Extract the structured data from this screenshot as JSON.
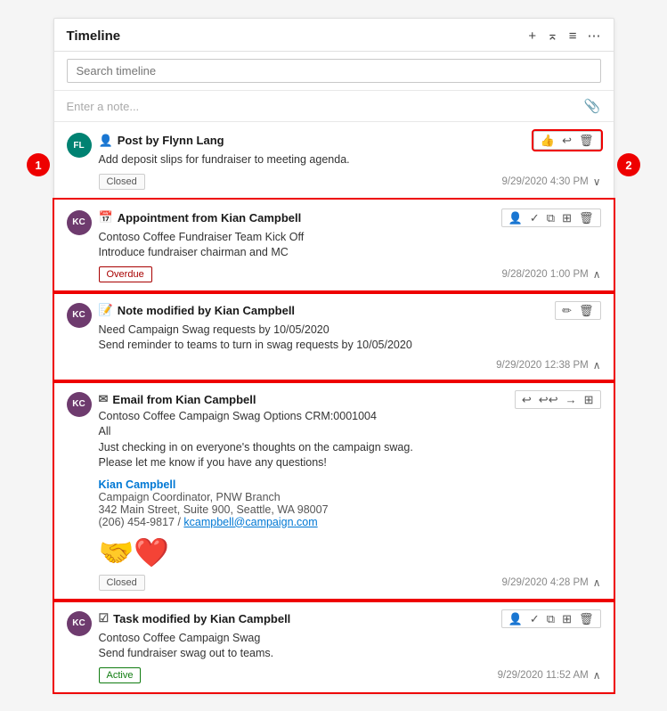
{
  "panel": {
    "title": "Timeline",
    "search_placeholder": "Search timeline",
    "note_placeholder": "Enter a note...",
    "header_icons": [
      "+",
      "⌄",
      "≡",
      "⋮"
    ]
  },
  "items": [
    {
      "id": "post",
      "type": "Post",
      "icon": "👤",
      "author": "Flynn Lang",
      "avatar_initials": "FL",
      "avatar_class": "avatar-fl",
      "body": "Add deposit slips for fundraiser to meeting agenda.",
      "badge": "Closed",
      "badge_class": "badge",
      "datetime": "9/29/2020 4:30 PM",
      "expanded": true,
      "actions": [
        "👍",
        "↩",
        "🗑"
      ]
    },
    {
      "id": "appointment",
      "type": "Appointment",
      "icon": "📅",
      "author": "Kian Campbell",
      "avatar_initials": "KC",
      "avatar_class": "avatar-kc",
      "body_lines": [
        "Contoso Coffee Fundraiser Team Kick Off",
        "Introduce fundraiser chairman and MC"
      ],
      "badge": "Overdue",
      "badge_class": "badge badge-overdue",
      "datetime": "9/28/2020 1:00 PM",
      "expanded": false,
      "actions": [
        "👤",
        "✓",
        "📋",
        "📋",
        "🗑"
      ]
    },
    {
      "id": "note",
      "type": "Note",
      "icon": "📝",
      "author": "Kian Campbell",
      "avatar_initials": "KC",
      "avatar_class": "avatar-kc",
      "body_lines": [
        "Need Campaign Swag requests by 10/05/2020",
        "Send reminder to teams to turn in swag requests by 10/05/2020"
      ],
      "datetime": "9/29/2020 12:38 PM",
      "expanded": false,
      "actions": [
        "✏",
        "🗑"
      ]
    },
    {
      "id": "email",
      "type": "Email",
      "icon": "✉",
      "author": "Kian Campbell",
      "avatar_initials": "KC",
      "avatar_class": "avatar-kc",
      "body_lines": [
        "Contoso Coffee Campaign Swag Options CRM:0001004",
        "All",
        "Just checking in on everyone's thoughts on the campaign swag.",
        "Please let me know if you have any questions!"
      ],
      "sig_name": "Kian Campbell",
      "sig_title": "Campaign Coordinator, PNW Branch",
      "sig_address": "342 Main Street, Suite 900, Seattle, WA 98007",
      "sig_phone": "(206) 454-9817",
      "sig_email": "kcampbell@campaign.com",
      "badge": "Closed",
      "badge_class": "badge",
      "datetime": "9/29/2020 4:28 PM",
      "expanded": false,
      "actions": [
        "↩",
        "↩↩",
        "→",
        "📋"
      ]
    },
    {
      "id": "task",
      "type": "Task",
      "icon": "☑",
      "author": "Kian Campbell",
      "avatar_initials": "KC",
      "avatar_class": "avatar-kc",
      "body_lines": [
        "Contoso Coffee Campaign Swag",
        "Send fundraiser swag out to teams."
      ],
      "badge": "Active",
      "badge_class": "badge badge-active",
      "datetime": "9/29/2020 11:52 AM",
      "expanded": false,
      "actions": [
        "👤",
        "✓",
        "📋",
        "📋",
        "🗑"
      ]
    }
  ]
}
